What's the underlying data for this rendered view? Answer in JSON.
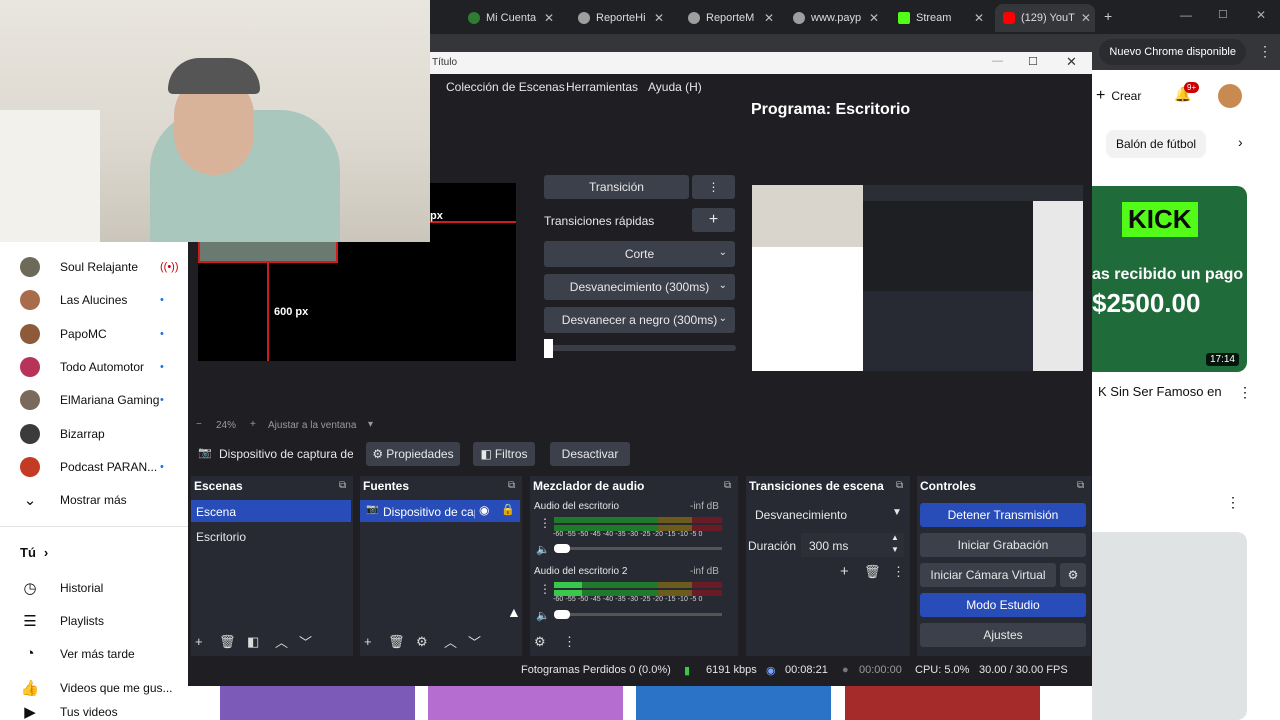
{
  "chrome": {
    "tabs": [
      {
        "label": "Mi Cuenta",
        "color": "#2e7d32"
      },
      {
        "label": "ReporteHi",
        "color": "#9e9e9e"
      },
      {
        "label": "ReporteM",
        "color": "#9e9e9e"
      },
      {
        "label": "www.payp",
        "color": "#9e9e9e"
      },
      {
        "label": "Stream",
        "color": "#53fc18"
      },
      {
        "label": "(129) YouT",
        "color": "#ff0000"
      }
    ],
    "update_label": "Nuevo Chrome disponible"
  },
  "sidebar": {
    "channels": [
      {
        "name": "Soul Relajante",
        "live": true,
        "color": "#6d6a5a"
      },
      {
        "name": "Las Alucines",
        "live": false,
        "color": "#a86c4a"
      },
      {
        "name": "PapoMC",
        "live": false,
        "color": "#8d5a3a"
      },
      {
        "name": "Todo Automotor",
        "live": false,
        "color": "#b8335a"
      },
      {
        "name": "ElMariana Gaming",
        "live": false,
        "color": "#7a6a5c"
      },
      {
        "name": "Bizarrap",
        "live": false,
        "color": "#3b3b3b"
      },
      {
        "name": "Podcast PARAN...",
        "live": false,
        "color": "#c23b22"
      }
    ],
    "show_more": "Mostrar más",
    "you_label": "Tú",
    "you_items": [
      {
        "label": "Historial",
        "icon": "history-icon"
      },
      {
        "label": "Playlists",
        "icon": "playlists-icon"
      },
      {
        "label": "Ver más tarde",
        "icon": "watch-later-icon"
      },
      {
        "label": "Videos que me gus...",
        "icon": "like-icon"
      },
      {
        "label": "Tus videos",
        "icon": "your-videos-icon"
      }
    ]
  },
  "yt_right": {
    "create_label": "Crear",
    "notif_count": "9+",
    "chip_label": "Balón de fútbol",
    "thumb_kick": "KICK",
    "thumb_line1": "as recibido un pago",
    "thumb_amount": "$2500.00",
    "duration": "17:14",
    "video_title": "K Sin Ser Famoso en"
  },
  "obs": {
    "window_title": "Título",
    "menu": [
      "Colección de Escenas",
      "Herramientas",
      "Ayuda (H)"
    ],
    "program_label": "Programa: Escritorio",
    "preview_px": "px",
    "preview_600": "600 px",
    "transition_label": "Transición",
    "quick_transitions": "Transiciones rápidas",
    "quick_list": [
      "Corte",
      "Desvanecimiento (300ms)",
      "Desvanecer a negro (300ms)"
    ],
    "zoom": "24%",
    "fit_label": "Ajustar a la ventana",
    "source_name": "Dispositivo de captura de v",
    "properties_label": "Propiedades",
    "filters_label": "Filtros",
    "deactivate_label": "Desactivar",
    "docks": {
      "scenes_title": "Escenas",
      "scenes": [
        "Escena",
        "Escritorio"
      ],
      "sources_title": "Fuentes",
      "sources": [
        "Dispositivo de cap"
      ],
      "mixer_title": "Mezclador de audio",
      "mixer": [
        {
          "name": "Audio del escritorio",
          "level": "-inf dB"
        },
        {
          "name": "Audio del escritorio 2",
          "level": "-inf dB"
        }
      ],
      "ticks": "-60 -55 -50 -45 -40 -35 -30 -25 -20 -15 -10  -5  0",
      "transitions_title": "Transiciones de escena",
      "transition_select": "Desvanecimiento",
      "duration_label": "Duración",
      "duration_value": "300 ms",
      "controls_title": "Controles",
      "controls": [
        "Detener Transmisión",
        "Iniciar Grabación",
        "Iniciar Cámara Virtual",
        "Modo Estudio",
        "Ajustes"
      ]
    },
    "status": {
      "dropped": "Fotogramas Perdidos 0 (0.0%)",
      "bitrate": "6191 kbps",
      "stream_time": "00:08:21",
      "rec_time": "00:00:00",
      "cpu": "CPU: 5.0%",
      "fps": "30.00 / 30.00 FPS"
    }
  },
  "colors": {
    "obs_bg": "#1f1f23",
    "accent_blue": "#284cb8",
    "live_red": "#cc0000"
  }
}
